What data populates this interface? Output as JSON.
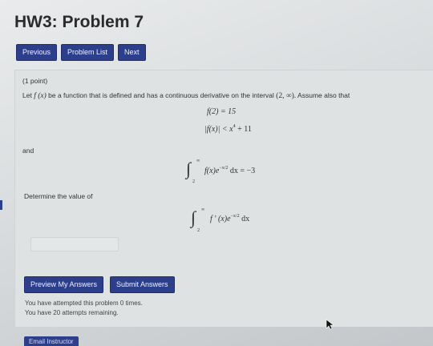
{
  "page": {
    "title": "HW3: Problem 7"
  },
  "nav": {
    "previous": "Previous",
    "problem_list": "Problem List",
    "next": "Next"
  },
  "problem": {
    "points": "(1 point)",
    "intro_prefix": "Let",
    "intro_fx": "f (x)",
    "intro_middle": "be a function that is defined and has a continuous derivative on the interval",
    "interval": "(2, ∞).",
    "intro_suffix": "Assume also that",
    "eq1": "f(2) = 15",
    "eq2_lhs": "|f(x)| < x",
    "eq2_exp": "4",
    "eq2_rhs": "+ 11",
    "and": "and",
    "int1_upper": "∞",
    "int1_lower": "2",
    "int1_body": "f(x)e",
    "int1_exp": "−x/2",
    "int1_rhs": "dx = −3",
    "determine": "Determine the value of",
    "int2_upper": "∞",
    "int2_lower": "2",
    "int2_body": "f ′ (x)e",
    "int2_exp": "−x/2",
    "int2_rhs": "dx"
  },
  "actions": {
    "preview": "Preview My Answers",
    "submit": "Submit Answers"
  },
  "status": {
    "attempted": "You have attempted this problem 0 times.",
    "remaining": "You have 20 attempts remaining."
  },
  "footer": {
    "email": "Email Instructor"
  },
  "colors": {
    "button_bg": "#2d3e8a",
    "text": "#333333"
  }
}
